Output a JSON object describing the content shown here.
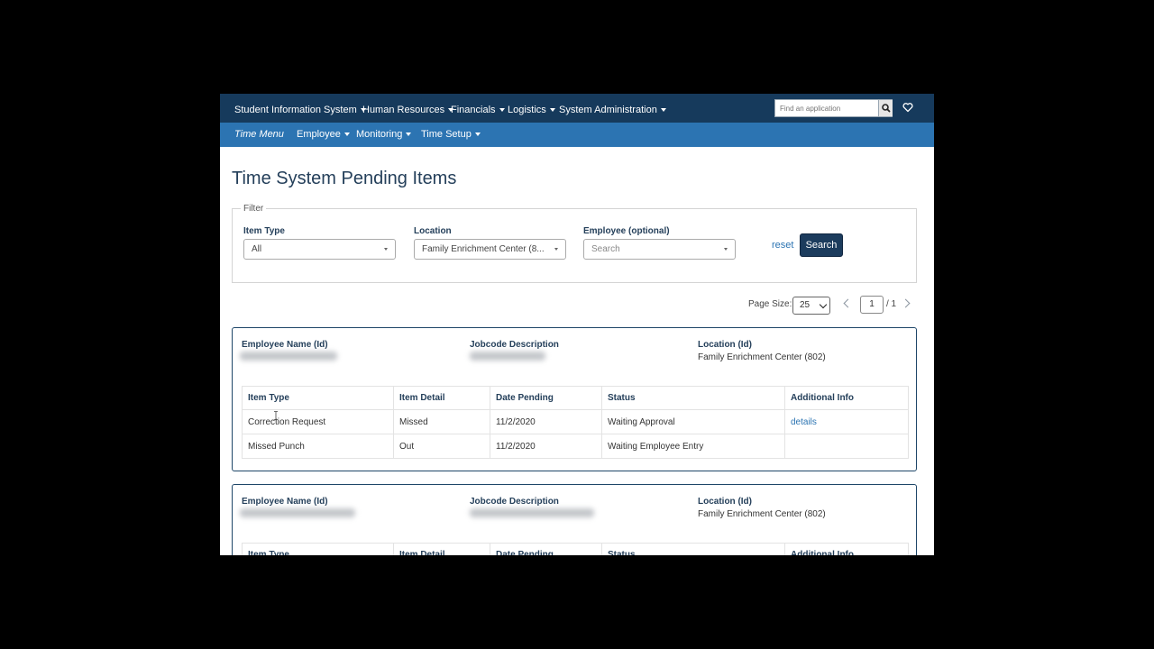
{
  "top_nav": {
    "items": [
      {
        "label": "Student Information System"
      },
      {
        "label": "Human Resources"
      },
      {
        "label": "Financials"
      },
      {
        "label": "Logistics"
      },
      {
        "label": "System Administration"
      }
    ],
    "search_placeholder": "Find an application",
    "search_icon": "magnifier-icon",
    "favorites_icon": "heart-icon"
  },
  "sub_nav": {
    "brand": "Time Menu",
    "items": [
      {
        "label": "Employee"
      },
      {
        "label": "Monitoring"
      },
      {
        "label": "Time Setup"
      }
    ]
  },
  "page": {
    "title": "Time System Pending Items"
  },
  "filter": {
    "legend": "Filter",
    "item_type": {
      "label": "Item Type",
      "value": "All"
    },
    "location": {
      "label": "Location",
      "value": "Family Enrichment Center (8..."
    },
    "employee": {
      "label": "Employee (optional)",
      "placeholder": "Search"
    },
    "reset_label": "reset",
    "search_label": "Search"
  },
  "pagination": {
    "page_size_label": "Page Size:",
    "page_size": "25",
    "current_page": "1",
    "total": "/ 1"
  },
  "cards": [
    {
      "employee_label": "Employee Name (Id)",
      "jobcode_label": "Jobcode Description",
      "location_label": "Location (Id)",
      "location_value": "Family Enrichment Center (802)",
      "columns": [
        "Item Type",
        "Item Detail",
        "Date Pending",
        "Status",
        "Additional Info"
      ],
      "rows": [
        {
          "item_type": "Correction Request",
          "item_detail": "Missed",
          "date_pending": "11/2/2020",
          "status": "Waiting Approval",
          "additional_info": "details"
        },
        {
          "item_type": "Missed Punch",
          "item_detail": "Out",
          "date_pending": "11/2/2020",
          "status": "Waiting Employee Entry",
          "additional_info": ""
        }
      ]
    },
    {
      "employee_label": "Employee Name (Id)",
      "jobcode_label": "Jobcode Description",
      "location_label": "Location (Id)",
      "location_value": "Family Enrichment Center (802)",
      "columns": [
        "Item Type",
        "Item Detail",
        "Date Pending",
        "Status",
        "Additional Info"
      ]
    }
  ],
  "colors": {
    "top_nav_bg": "#163a5c",
    "sub_nav_bg": "#2c74b2",
    "title": "#243f5a",
    "search_button": "#1c3c5d",
    "link": "#2c74b2"
  }
}
